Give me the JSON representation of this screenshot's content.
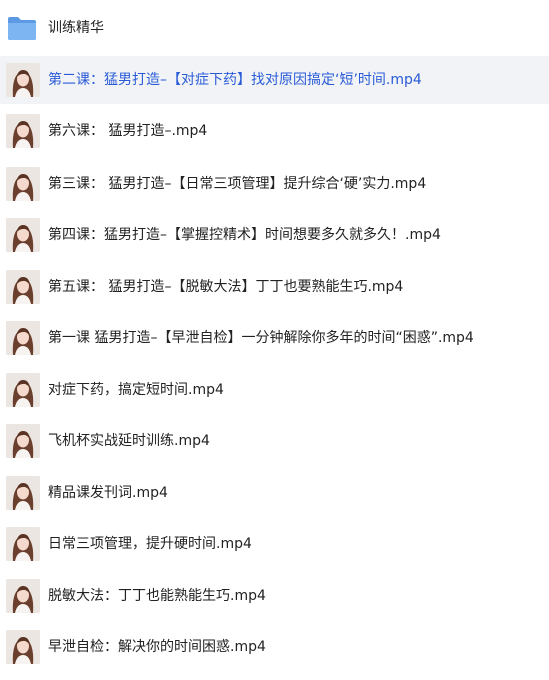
{
  "folder": {
    "name": "训练精华",
    "icon": "folder-icon",
    "color": "#6aa8f0"
  },
  "files": [
    {
      "name": "第二课：猛男打造–【对症下药】找对原因搞定‘短’时间.mp4",
      "selected": true
    },
    {
      "name": "第六课： 猛男打造–.mp4",
      "selected": false
    },
    {
      "name": "第三课： 猛男打造–【日常三项管理】提升综合‘硬’实力.mp4",
      "selected": false
    },
    {
      "name": "第四课：猛男打造–【掌握控精术】时间想要多久就多久！.mp4",
      "selected": false
    },
    {
      "name": "第五课： 猛男打造–【脱敏大法】丁丁也要熟能生巧.mp4",
      "selected": false
    },
    {
      "name": "第一课 猛男打造–【早泄自检】一分钟解除你多年的时间“困惑”.mp4",
      "selected": false
    },
    {
      "name": "对症下药，搞定短时间.mp4",
      "selected": false
    },
    {
      "name": "飞机杯实战延时训练.mp4",
      "selected": false
    },
    {
      "name": "精品课发刊词.mp4",
      "selected": false
    },
    {
      "name": "日常三项管理，提升硬时间.mp4",
      "selected": false
    },
    {
      "name": "脱敏大法：丁丁也能熟能生巧.mp4",
      "selected": false
    },
    {
      "name": "早泄自检：解决你的时间困惑.mp4",
      "selected": false
    }
  ],
  "colors": {
    "selected_text": "#2a5bd7",
    "selected_bg": "#f1f3f6",
    "text": "#222222"
  }
}
